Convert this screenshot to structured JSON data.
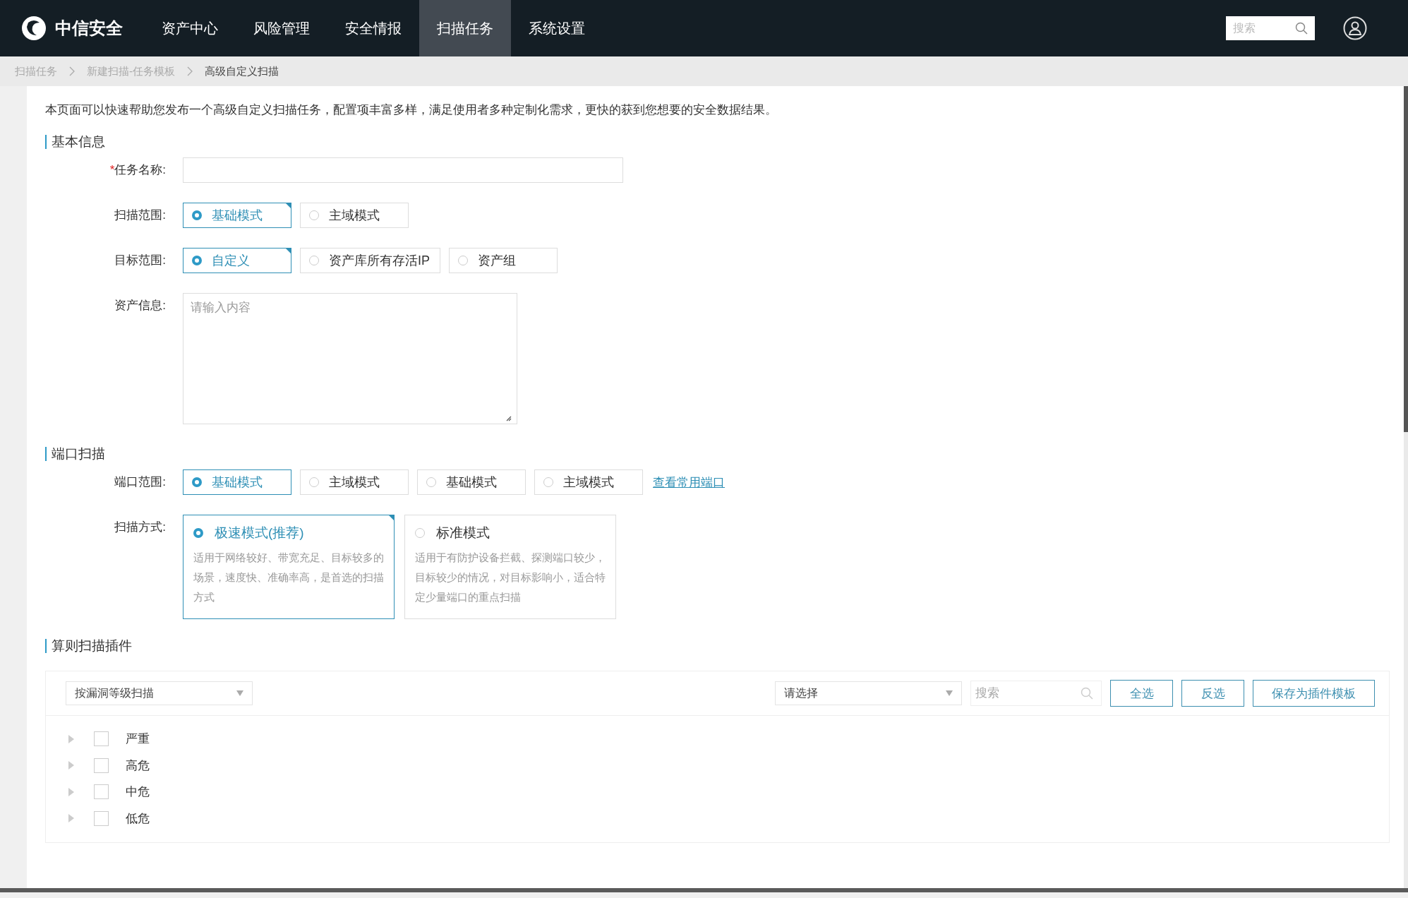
{
  "navbar": {
    "logo": "中信安全",
    "items": [
      {
        "label": "资产中心",
        "selected": false
      },
      {
        "label": "风险管理",
        "selected": false
      },
      {
        "label": "安全情报",
        "selected": false
      },
      {
        "label": "扫描任务",
        "selected": true
      },
      {
        "label": "系统设置",
        "selected": false
      }
    ],
    "search": {
      "placeholder": "搜索"
    }
  },
  "breadcrumb": [
    {
      "label": "扫描任务",
      "current": false
    },
    {
      "label": "新建扫描-任务模板",
      "current": false
    },
    {
      "label": "高级自定义扫描",
      "current": true
    }
  ],
  "intro": "本页面可以快速帮助您发布一个高级自定义扫描任务，配置项丰富多样，满足使用者多种定制化需求，更快的获到您想要的安全数据结果。",
  "sections": [
    {
      "title": "基本信息",
      "fields": [
        {
          "kind": "text",
          "label": "任务名称:",
          "required_mark": "*"
        },
        {
          "kind": "radio",
          "label": "扫描范围:",
          "options": [
            {
              "label": "基础模式",
              "selected": true,
              "flagged": true
            },
            {
              "label": "主域模式",
              "selected": false,
              "flagged": false
            }
          ]
        },
        {
          "kind": "radio",
          "label": "目标范围:",
          "options": [
            {
              "label": "自定义",
              "selected": true,
              "flagged": true
            },
            {
              "label": "资产库所有存活IP",
              "selected": false,
              "flagged": false
            },
            {
              "label": "资产组",
              "selected": false,
              "flagged": false
            }
          ]
        },
        {
          "kind": "textarea",
          "label": "资产信息:",
          "placeholder": "请输入内容"
        }
      ]
    },
    {
      "title": "端口扫描",
      "fields": [
        {
          "kind": "radio",
          "label": "端口范围:",
          "options": [
            {
              "label": "基础模式",
              "selected": true,
              "flagged": false
            },
            {
              "label": "主域模式",
              "selected": false,
              "flagged": false
            },
            {
              "label": "基础模式",
              "selected": false,
              "flagged": false
            },
            {
              "label": "主域模式",
              "selected": false,
              "flagged": false
            }
          ],
          "link": "查看常用端口"
        },
        {
          "kind": "cards",
          "label": "扫描方式:",
          "options": [
            {
              "label": "极速模式(推荐)",
              "description": "适用于网络较好、带宽充足、目标较多的场景，速度快、准确率高，是首选的扫描方式",
              "selected": true,
              "flagged": true
            },
            {
              "label": "标准模式",
              "description": "适用于有防护设备拦截、探测端口较少，目标较少的情况，对目标影响小，适合特定少量端口的重点扫描",
              "selected": false,
              "flagged": false
            }
          ]
        }
      ]
    },
    {
      "title": "算则扫描插件",
      "plugins": {
        "group_by": "按漏洞等级扫描",
        "select": "请选择",
        "search_placeholder": "搜索",
        "buttons": [
          "全选",
          "反选",
          "保存为插件模板"
        ],
        "tree": [
          {
            "label": "严重",
            "checked": false,
            "expanded": false
          },
          {
            "label": "高危",
            "checked": false,
            "expanded": false
          },
          {
            "label": "中危",
            "checked": false,
            "expanded": false
          },
          {
            "label": "低危",
            "checked": false,
            "expanded": false
          }
        ]
      }
    }
  ]
}
